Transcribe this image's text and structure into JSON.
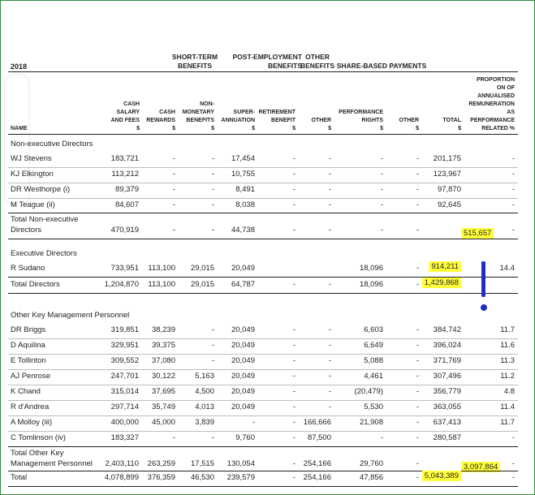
{
  "year": "2018",
  "group_headers": {
    "short_term": "SHORT-TERM\nBENEFITS",
    "post_employment": "POST-EMPLOYMENT\nBENEFITS",
    "other_benefits": "OTHER\nBENEFITS",
    "share_based": "SHARE-BASED PAYMENTS"
  },
  "columns": {
    "name": "NAME",
    "cash_salary": "CASH\nSALARY\nAND FEES\n$",
    "cash_rewards": "CASH\nREWARDS\n$",
    "non_monetary": "NON-\nMONETARY\nBENEFITS\n$",
    "super": "SUPER-\nANNUATION\n$",
    "retirement": "RETIREMENT\nBENEFIT\n$",
    "other": "OTHER\n$",
    "performance_rights": "PERFORMANCE\nRIGHTS\n$",
    "other2": "OTHER\n$",
    "total": "TOTAL\n$",
    "proportion": "PROPORTION\nON OF\nANNUALISED\nREMUNERATION\nAS\nPERFORMANCE\nRELATED %"
  },
  "sections": {
    "non_exec": "Non-executive Directors",
    "exec": "Executive Directors",
    "kmp": "Other Key Management Personnel"
  },
  "non_exec_rows": [
    [
      "WJ Stevens",
      "183,721",
      "-",
      "-",
      "17,454",
      "-",
      "-",
      "-",
      "-",
      "201,175",
      "-"
    ],
    [
      "KJ Elkington",
      "113,212",
      "-",
      "-",
      "10,755",
      "-",
      "-",
      "-",
      "-",
      "123,967",
      "-"
    ],
    [
      "DR Westhorpe (i)",
      "89,379",
      "-",
      "-",
      "8,491",
      "-",
      "-",
      "-",
      "-",
      "97,870",
      "-"
    ],
    [
      "M Teague (ii)",
      "84,607",
      "-",
      "-",
      "8,038",
      "-",
      "-",
      "-",
      "-",
      "92,645",
      "-"
    ]
  ],
  "non_exec_total": [
    "Total Non-executive",
    "Directors",
    "470,919",
    "-",
    "-",
    "44,738",
    "-",
    "-",
    "-",
    "-",
    "515,657",
    "-"
  ],
  "exec_rows": [
    [
      "R Sudano",
      "733,951",
      "113,100",
      "29,015",
      "20,049",
      "",
      "",
      "18,096",
      "-",
      "914,211",
      "14.4"
    ]
  ],
  "total_directors": [
    "Total Directors",
    "1,204,870",
    "113,100",
    "29,015",
    "64,787",
    "-",
    "-",
    "18,096",
    "-",
    "1,429,868",
    ""
  ],
  "kmp_rows": [
    [
      "DR Briggs",
      "319,851",
      "38,239",
      "-",
      "20,049",
      "-",
      "-",
      "6,603",
      "-",
      "384,742",
      "11.7"
    ],
    [
      "D Aquilina",
      "329,951",
      "39,375",
      "-",
      "20,049",
      "-",
      "-",
      "6,649",
      "-",
      "396,024",
      "11.6"
    ],
    [
      "E Tollinton",
      "309,552",
      "37,080",
      "-",
      "20,049",
      "-",
      "-",
      "5,088",
      "-",
      "371,769",
      "11.3"
    ],
    [
      "AJ Penrose",
      "247,701",
      "30,122",
      "5,163",
      "20,049",
      "-",
      "-",
      "4,461",
      "-",
      "307,496",
      "11.2"
    ],
    [
      "K Chand",
      "315,014",
      "37,695",
      "4,500",
      "20,049",
      "-",
      "-",
      "(20,479)",
      "-",
      "356,779",
      "4.8"
    ],
    [
      "R d'Andrea",
      "297,714",
      "35,749",
      "4,013",
      "20,049",
      "-",
      "-",
      "5,530",
      "-",
      "363,055",
      "11.4"
    ],
    [
      "A Molloy (iii)",
      "400,000",
      "45,000",
      "3,839",
      "-",
      "-",
      "166,666",
      "21,908",
      "-",
      "637,413",
      "11.7"
    ],
    [
      "C Tomlinson (iv)",
      "183,327",
      "-",
      "-",
      "9,760",
      "-",
      "87,500",
      "-",
      "-",
      "280,587",
      "-"
    ]
  ],
  "kmp_total": [
    "Total Other Key",
    "Management Personnel",
    "2,403,110",
    "263,259",
    "17,515",
    "130,054",
    "-",
    "254,166",
    "29,760",
    "-",
    "3,097,864",
    "-"
  ],
  "grand_total": [
    "Total",
    "4,078,899",
    "376,359",
    "46,530",
    "239,579",
    "-",
    "254,166",
    "47,856",
    "-",
    "5,043,389",
    "-"
  ],
  "highlight_color": "#ffff3c",
  "marker_color": "#1f2fc4"
}
